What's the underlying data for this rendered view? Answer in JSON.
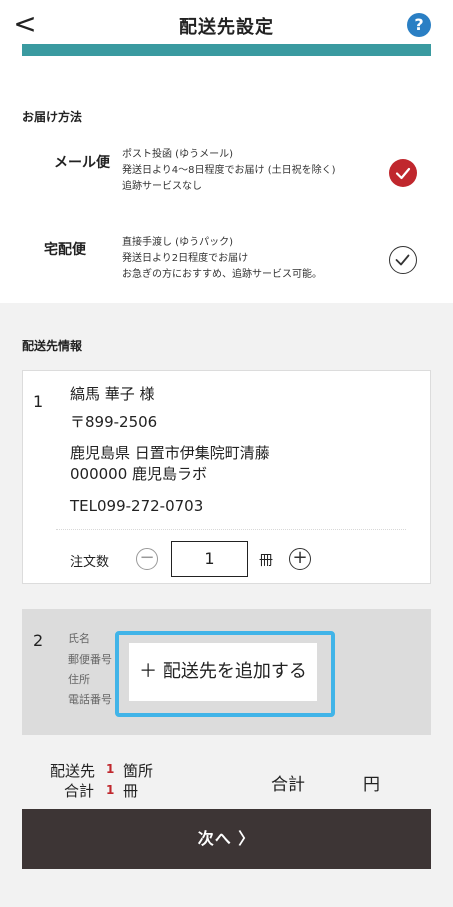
{
  "header": {
    "back_symbol": "<",
    "title": "配送先設定",
    "help_symbol": "?"
  },
  "delivery_method": {
    "heading": "お届け方法",
    "options": [
      {
        "label": "メール便",
        "lines": [
          "ポスト投函 (ゆうメール)",
          "発送日より4〜8日程度でお届け (土日祝を除く)",
          "追跡サービスなし"
        ],
        "selected": true
      },
      {
        "label": "宅配便",
        "lines": [
          "直接手渡し (ゆうパック)",
          "発送日より2日程度でお届け",
          "お急ぎの方におすすめ、追跡サービス可能。"
        ],
        "selected": false
      }
    ]
  },
  "shipping_info": {
    "heading": "配送先情報",
    "address1": {
      "number": "1",
      "name": "縞馬 華子 様",
      "postal": "〒899-2506",
      "address_line1": "鹿児島県 日置市伊集院町清藤",
      "address_line2": "000000 鹿児島ラボ",
      "tel": "TEL099-272-0703",
      "qty_label": "注文数",
      "qty_value": "1",
      "qty_unit": "冊",
      "minus_symbol": "−",
      "plus_symbol": "+"
    },
    "address2": {
      "number": "2",
      "labels": [
        "氏名",
        "郵便番号",
        "住所",
        "電話番号"
      ],
      "add_button": "＋ 配送先を追加する"
    }
  },
  "summary": {
    "dest_label": "配送先",
    "dest_count": "1",
    "dest_unit": "箇所",
    "total_label": "合計",
    "total_count": "1",
    "total_unit": "冊",
    "sum_label": "合計",
    "currency": "円"
  },
  "next_button": "次へ 〉",
  "colors": {
    "accent_red": "#c0272d",
    "teal": "#3a9aa0",
    "highlight_blue": "#41b4e8",
    "dark_button": "#3d3535"
  }
}
